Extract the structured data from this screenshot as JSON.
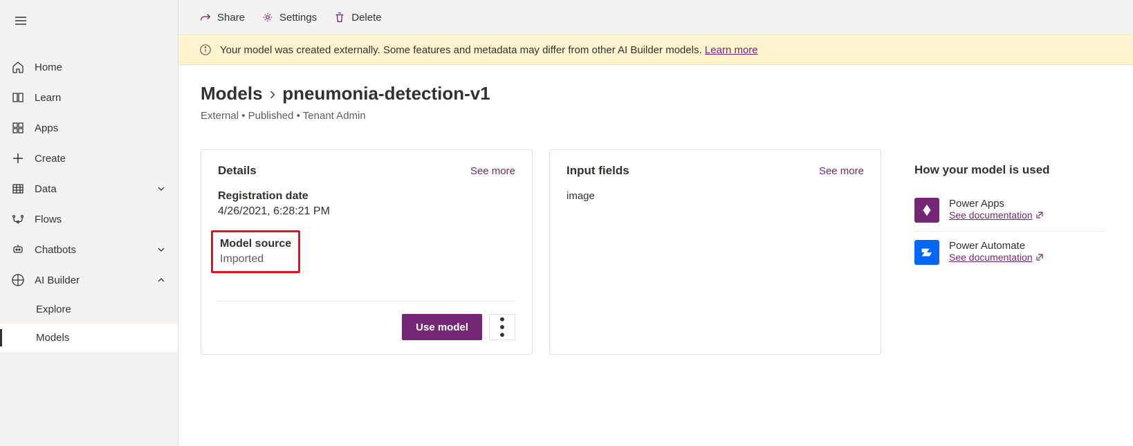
{
  "sidebar": {
    "items": [
      {
        "label": "Home"
      },
      {
        "label": "Learn"
      },
      {
        "label": "Apps"
      },
      {
        "label": "Create"
      },
      {
        "label": "Data"
      },
      {
        "label": "Flows"
      },
      {
        "label": "Chatbots"
      },
      {
        "label": "AI Builder"
      }
    ],
    "subitems": [
      {
        "label": "Explore"
      },
      {
        "label": "Models"
      }
    ]
  },
  "toolbar": {
    "share": "Share",
    "settings": "Settings",
    "delete": "Delete"
  },
  "banner": {
    "text": "Your model was created externally. Some features and metadata may differ from other AI Builder models.",
    "link": "Learn more"
  },
  "breadcrumb": {
    "root": "Models",
    "current": "pneumonia-detection-v1"
  },
  "meta": "External  •  Published  •  Tenant Admin",
  "details": {
    "title": "Details",
    "see_more": "See more",
    "registration_label": "Registration date",
    "registration_value": "4/26/2021, 6:28:21 PM",
    "source_label": "Model source",
    "source_value": "Imported",
    "use_model": "Use model"
  },
  "inputs": {
    "title": "Input fields",
    "see_more": "See more",
    "field": "image"
  },
  "usage": {
    "title": "How your model is used",
    "powerapps": "Power Apps",
    "powerautomate": "Power Automate",
    "doc_link": "See documentation"
  }
}
